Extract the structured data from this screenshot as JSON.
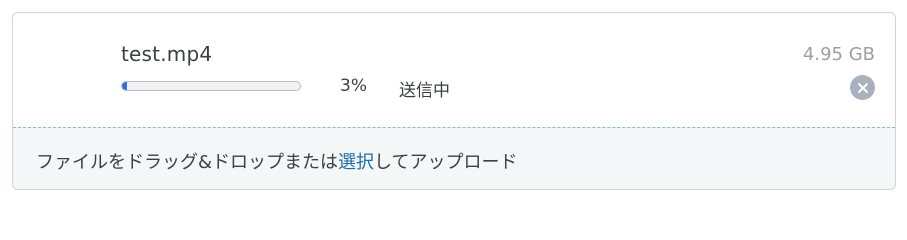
{
  "upload": {
    "file": {
      "name": "test.mp4",
      "size": "4.95 GB",
      "progress_percent": 3,
      "progress_label": "3%",
      "status": "送信中",
      "cancel_icon": "close-icon"
    },
    "dropzone": {
      "text_before": "ファイルをドラッグ&ドロップまたは",
      "link_text": "選択",
      "text_after": "してアップロード"
    }
  },
  "colors": {
    "progress_fill": "#2f6fd6",
    "link": "#1d6fa5",
    "cancel_button": "#a9b2bc"
  }
}
